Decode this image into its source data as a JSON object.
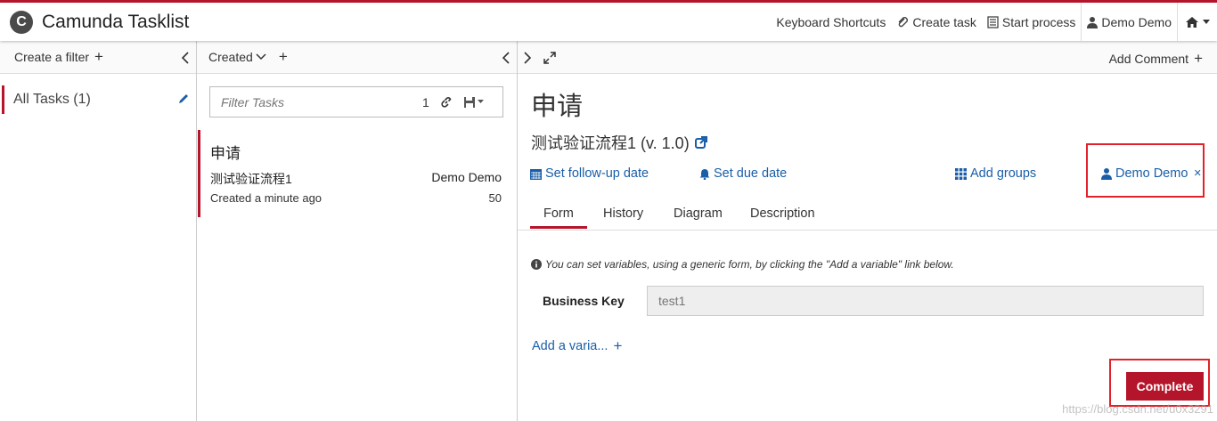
{
  "header": {
    "app_title": "Camunda Tasklist",
    "logo_letter": "C",
    "nav": {
      "keyboard_shortcuts": "Keyboard Shortcuts",
      "create_task": "Create task",
      "start_process": "Start process",
      "user": "Demo Demo"
    }
  },
  "filters": {
    "create_filter": "Create a filter",
    "items": [
      {
        "label": "All Tasks (1)"
      }
    ]
  },
  "list": {
    "sort_label": "Created",
    "filter_placeholder": "Filter Tasks",
    "filter_count": "1",
    "tasks": [
      {
        "name": "申请",
        "process": "测试验证流程1",
        "assignee": "Demo Demo",
        "created": "Created a minute ago",
        "priority": "50"
      }
    ]
  },
  "detail": {
    "add_comment": "Add Comment",
    "title": "申请",
    "process": "测试验证流程1 (v. 1.0)",
    "actions": {
      "follow_up": "Set follow-up date",
      "due_date": "Set due date",
      "add_groups": "Add groups",
      "assignee": "Demo Demo",
      "remove_assignee": "×"
    },
    "tabs": [
      {
        "label": "Form"
      },
      {
        "label": "History"
      },
      {
        "label": "Diagram"
      },
      {
        "label": "Description"
      }
    ],
    "form": {
      "hint": "You can set variables, using a generic form, by clicking the \"Add a variable\" link below.",
      "business_key_label": "Business Key",
      "business_key_value": "test1",
      "add_variable": "Add a varia...",
      "complete_label": "Complete"
    }
  },
  "watermark": "https://blog.csdn.net/u0x3291",
  "colors": {
    "brand_red": "#b5152b",
    "link_blue": "#1a5ea8",
    "highlight_red": "#e0232a"
  }
}
